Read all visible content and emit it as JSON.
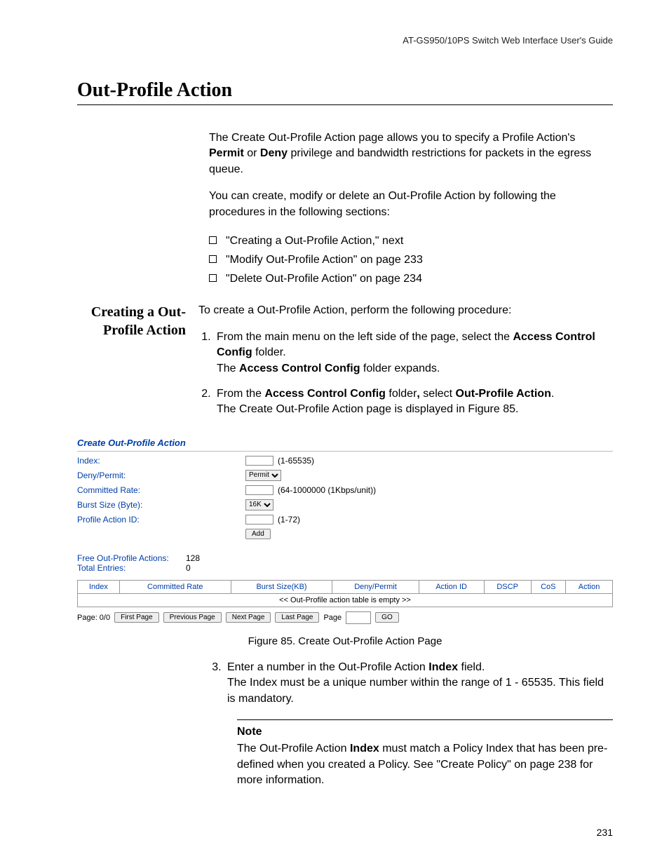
{
  "header": "AT-GS950/10PS Switch Web Interface User's Guide",
  "title": "Out-Profile Action",
  "intro": {
    "p1_prefix": "The Create Out-Profile Action page allows you to specify a Profile Action's ",
    "p1_b1": "Permit",
    "p1_mid": " or ",
    "p1_b2": "Deny",
    "p1_suffix": " privilege and bandwidth restrictions for packets in the egress queue.",
    "p2": "You can create, modify or delete an Out-Profile Action by following the procedures in the following sections:",
    "bullets": [
      "\"Creating a Out-Profile Action,\"  next",
      "\"Modify Out-Profile Action\" on page 233",
      "\"Delete Out-Profile Action\" on page 234"
    ]
  },
  "side_heading": "Creating a Out-Profile Action",
  "procedure_intro": "To create a Out-Profile Action, perform the following procedure:",
  "steps": {
    "s1_a": "From the main menu on the left side of the page, select the ",
    "s1_b1": "Access Control Config",
    "s1_c": " folder.",
    "s1_d": "The ",
    "s1_b2": "Access Control Config",
    "s1_e": " folder expands.",
    "s2_a": "From the ",
    "s2_b1": "Access Control Config",
    "s2_b": " folder",
    "s2_comma": ", ",
    "s2_c": "select ",
    "s2_b2": "Out-Profile Action",
    "s2_d": ".",
    "s2_e": "The Create Out-Profile Action page is displayed in Figure 85.",
    "s3_a": "Enter a number in the Out-Profile Action ",
    "s3_b1": "Index",
    "s3_b": " field.",
    "s3_c": "The Index must be a unique number within the range of 1 - 65535. This field is mandatory."
  },
  "figure": {
    "panel_title": "Create Out-Profile Action",
    "rows": {
      "index_lbl": "Index:",
      "index_hint": "(1-65535)",
      "deny_lbl": "Deny/Permit:",
      "deny_value": "Permit",
      "rate_lbl": "Committed Rate:",
      "rate_hint": "(64-1000000 (1Kbps/unit))",
      "burst_lbl": "Burst Size (Byte):",
      "burst_value": "16K",
      "action_lbl": "Profile Action ID:",
      "action_hint": "(1-72)",
      "add_btn": "Add"
    },
    "stats": {
      "free_lbl": "Free Out-Profile Actions:",
      "free_val": "128",
      "total_lbl": "Total Entries:",
      "total_val": "0"
    },
    "table": {
      "headers": [
        "Index",
        "Committed Rate",
        "Burst Size(KB)",
        "Deny/Permit",
        "Action ID",
        "DSCP",
        "CoS",
        "Action"
      ],
      "empty": "<< Out-Profile action table is empty >>"
    },
    "pager": {
      "page_of": "Page: 0/0",
      "first": "First Page",
      "prev": "Previous Page",
      "next": "Next Page",
      "last": "Last Page",
      "page_lbl": "Page",
      "go": "GO"
    }
  },
  "caption": "Figure 85. Create Out-Profile Action Page",
  "note": {
    "heading": "Note",
    "a": "The Out-Profile Action ",
    "b1": "Index",
    "b": " must match a Policy Index that has been pre-defined when you created a Policy. See \"Create Policy\" on page 238 for more information."
  },
  "page_number": "231"
}
